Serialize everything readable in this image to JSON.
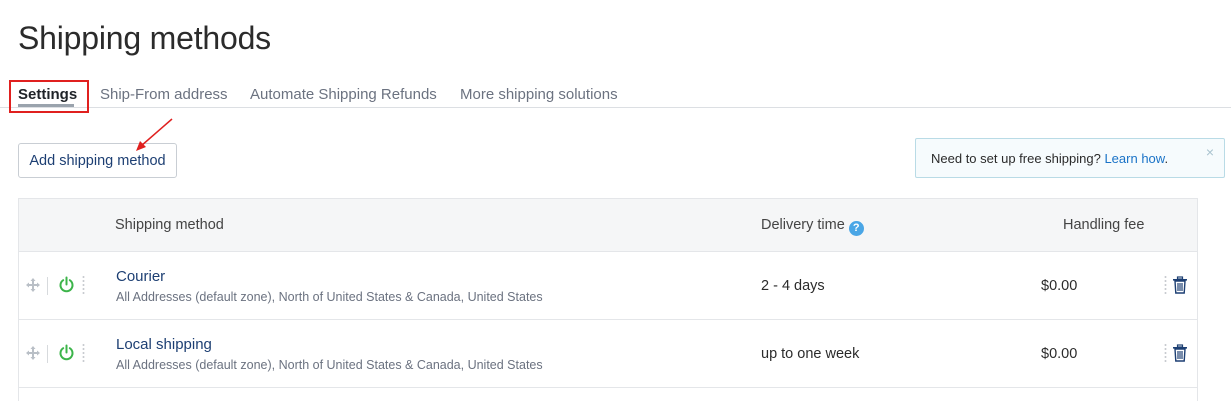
{
  "page": {
    "title": "Shipping methods"
  },
  "tabs": [
    {
      "label": "Settings",
      "active": true
    },
    {
      "label": "Ship-From address",
      "active": false
    },
    {
      "label": "Automate Shipping Refunds",
      "active": false
    },
    {
      "label": "More shipping solutions",
      "active": false
    }
  ],
  "toolbar": {
    "add_label": "Add shipping method"
  },
  "notice": {
    "text": "Need to set up free shipping? ",
    "link": "Learn how",
    "suffix": ".",
    "close": "×"
  },
  "table": {
    "headers": {
      "method": "Shipping method",
      "delivery": "Delivery time",
      "handling": "Handling fee",
      "help": "?"
    },
    "rows": [
      {
        "name": "Courier",
        "zones": "All Addresses (default zone), North of United States & Canada, United States",
        "delivery": "2 - 4 days",
        "fee": "$0.00"
      },
      {
        "name": "Local shipping",
        "zones": "All Addresses (default zone), North of United States & Canada, United States",
        "delivery": "up to one week",
        "fee": "$0.00"
      }
    ]
  },
  "colors": {
    "accent": "#1d3f73",
    "link": "#1a73c7",
    "power_on": "#3cb44a",
    "highlight": "#e0201f"
  },
  "icons": [
    "drag-handle-icon",
    "power-icon",
    "kebab-menu-icon",
    "trash-icon",
    "help-icon",
    "close-icon",
    "annotation-arrow"
  ]
}
